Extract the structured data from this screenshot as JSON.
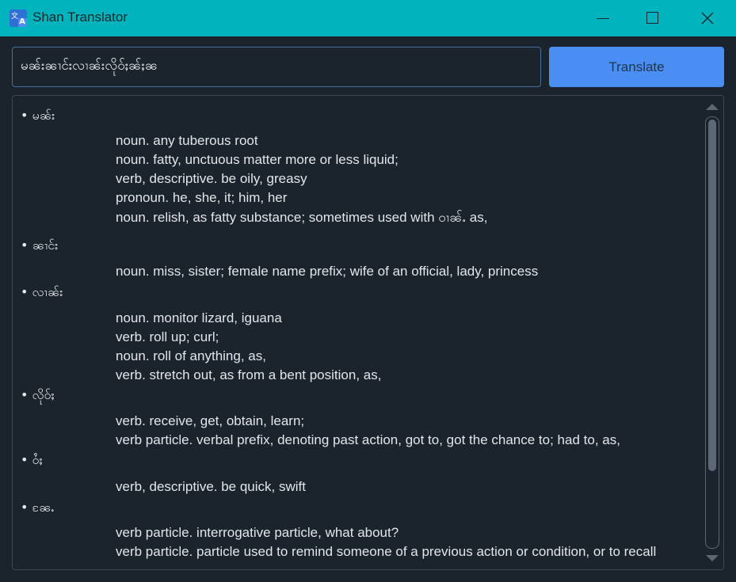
{
  "window": {
    "title": "Shan Translator",
    "icon": "translate-icon"
  },
  "input": {
    "value": "မၼ်းၼၢင်းလၢၼ်းလိုဝ်ႈၼ်ႈၼ"
  },
  "translate_button": {
    "label": "Translate"
  },
  "results": [
    {
      "word": "• မၼ်း",
      "definitions": [
        "noun. any tuberous root",
        "noun. fatty, unctuous matter more or less liquid;",
        "verb, descriptive. be oily, greasy",
        "pronoun. he, she, it; him, her",
        "noun. relish, as fatty substance; sometimes used with ဝၢၼ်ႉ as,"
      ]
    },
    {
      "word": "• ၼၢင်း",
      "definitions": [
        "noun. miss, sister; female name prefix; wife of an official, lady, princess"
      ]
    },
    {
      "word": "• လၢၼ်း",
      "definitions": [
        "noun. monitor lizard, iguana",
        "verb. roll up; curl;",
        "noun. roll of anything, as,",
        "verb. stretch out, as from a bent position, as,"
      ]
    },
    {
      "word": "• လိုဝ်ႈ",
      "definitions": [
        "verb. receive, get, obtain, learn;",
        "verb particle. verbal prefix, denoting past action, got to, got the chance to; had to, as,"
      ]
    },
    {
      "word": "• ဝႆႈ",
      "definitions": [
        "verb, descriptive. be quick, swift"
      ]
    },
    {
      "word": "• ၼႄႉ",
      "definitions": [
        "verb particle. interrogative particle, what about?",
        "verb particle. particle used to remind someone of a previous action or condition, or to recall"
      ]
    }
  ],
  "colors": {
    "titlebar": "#00b3bd",
    "background": "#1b232d",
    "accent": "#4a8ef3"
  }
}
